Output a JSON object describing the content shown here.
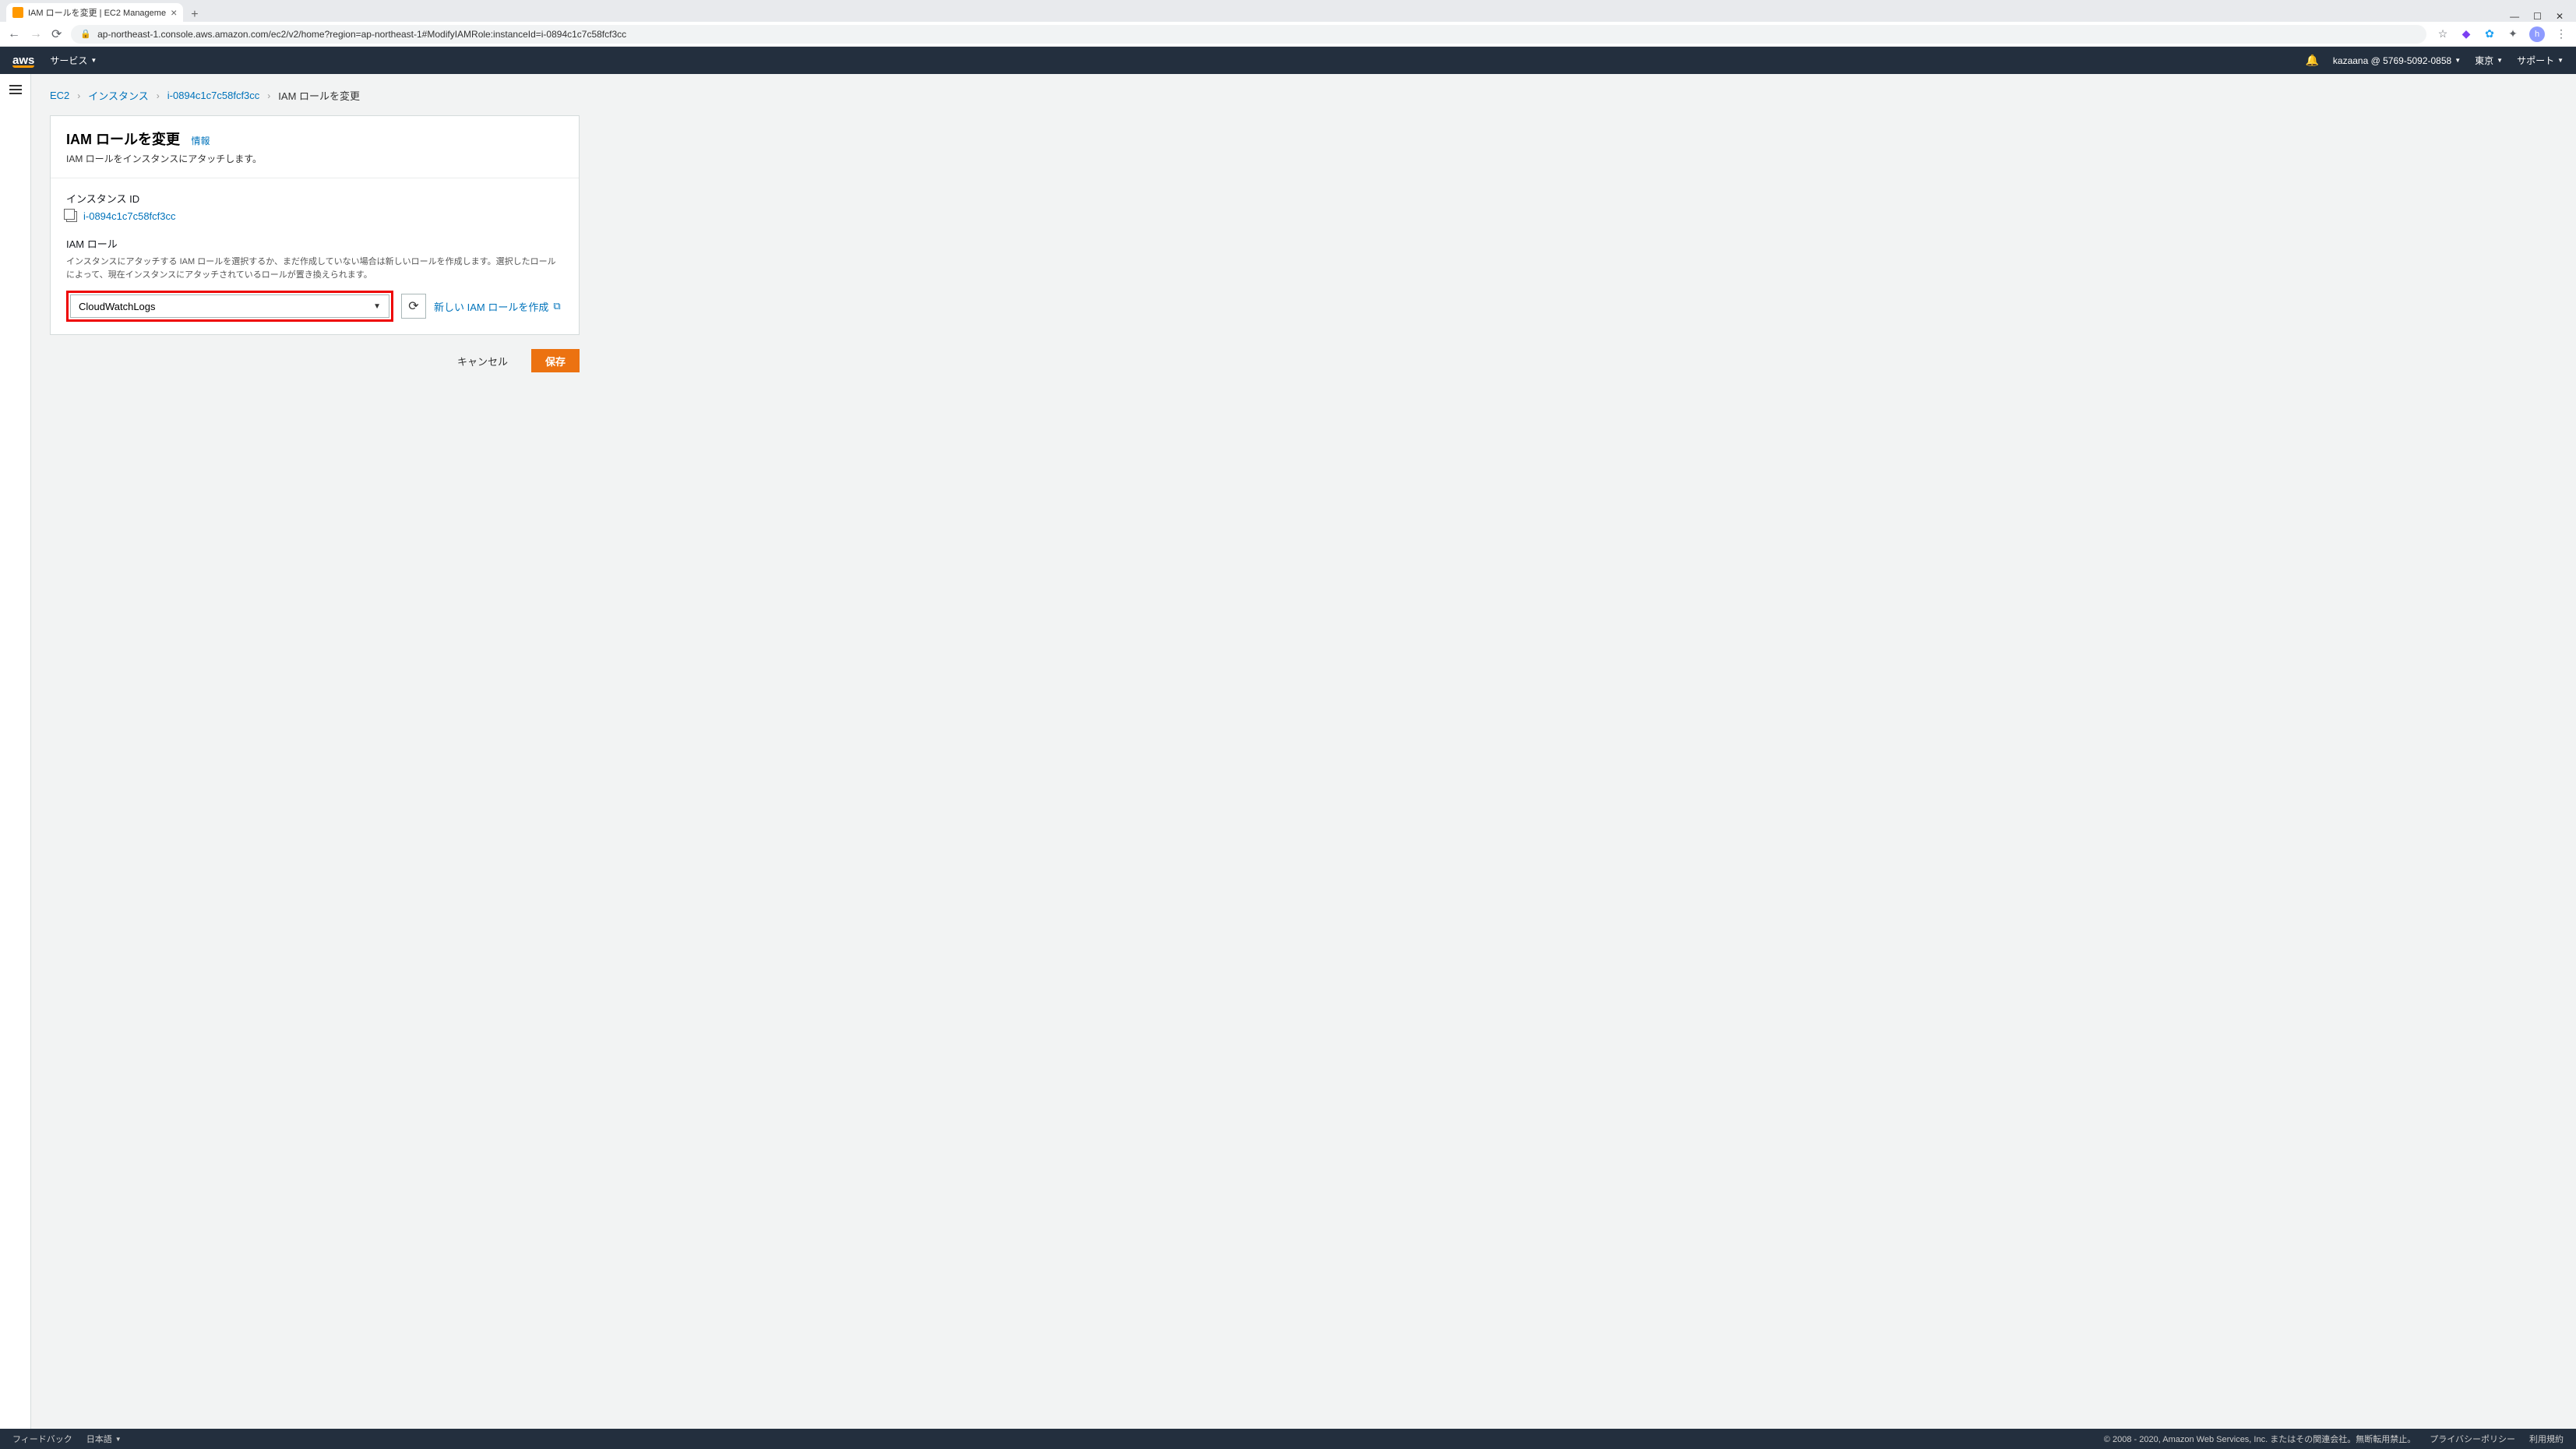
{
  "browser": {
    "tab_title": "IAM ロールを変更 | EC2 Manageme",
    "url": "ap-northeast-1.console.aws.amazon.com/ec2/v2/home?region=ap-northeast-1#ModifyIAMRole:instanceId=i-0894c1c7c58fcf3cc",
    "profile_initial": "h"
  },
  "aws_nav": {
    "logo": "aws",
    "services": "サービス",
    "account": "kazaana @ 5769-5092-0858",
    "region": "東京",
    "support": "サポート"
  },
  "breadcrumb": {
    "ec2": "EC2",
    "instances": "インスタンス",
    "instance_id": "i-0894c1c7c58fcf3cc",
    "current": "IAM ロールを変更"
  },
  "page": {
    "title": "IAM ロールを変更",
    "info": "情報",
    "subtitle": "IAM ロールをインスタンスにアタッチします。",
    "instance_id_label": "インスタンス ID",
    "instance_id_value": "i-0894c1c7c58fcf3cc",
    "role_label": "IAM ロール",
    "role_desc": "インスタンスにアタッチする IAM ロールを選択するか、まだ作成していない場合は新しいロールを作成します。選択したロールによって、現在インスタンスにアタッチされているロールが置き換えられます。",
    "role_selected": "CloudWatchLogs",
    "create_role": "新しい IAM ロールを作成",
    "cancel": "キャンセル",
    "save": "保存"
  },
  "footer": {
    "feedback": "フィードバック",
    "language": "日本語",
    "copyright": "© 2008 - 2020, Amazon Web Services, Inc. またはその関連会社。無断転用禁止。",
    "privacy": "プライバシーポリシー",
    "terms": "利用規約"
  }
}
